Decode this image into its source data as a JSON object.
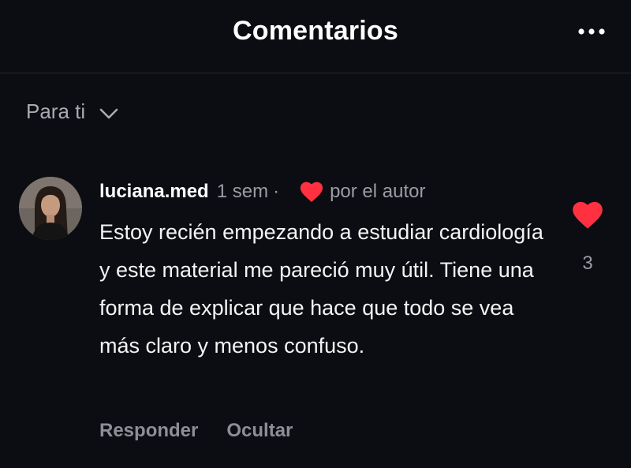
{
  "header": {
    "title": "Comentarios",
    "more_icon": "more-horizontal-icon"
  },
  "filter": {
    "label": "Para ti",
    "icon": "chevron-down-icon"
  },
  "comment": {
    "username": "luciana.med",
    "time": "1 sem",
    "separator": "·",
    "author_label": "por el autor",
    "author_heart_icon": "heart-icon",
    "author_heart_color": "#ff3040",
    "text": "Estoy recién empezando a estudiar cardiología y este material me pareció muy útil. Tiene una forma de explicar que hace que todo se vea más claro y menos confuso.",
    "reply_label": "Responder",
    "hide_label": "Ocultar",
    "like_icon": "heart-icon",
    "like_color": "#ff3040",
    "like_count": "3"
  }
}
